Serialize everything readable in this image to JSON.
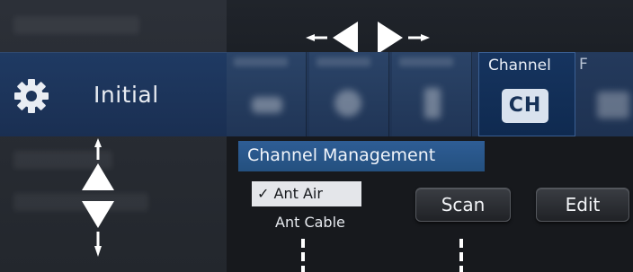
{
  "sidebar": {
    "selected_label": "Initial"
  },
  "tabs": {
    "channel_label": "Channel",
    "channel_icon_text": "CH",
    "next_label": "F"
  },
  "section": {
    "title": "Channel Management"
  },
  "sources": {
    "selected": "Ant Air",
    "other": "Ant Cable",
    "checkmark": "✓"
  },
  "buttons": {
    "scan": "Scan",
    "edit": "Edit"
  }
}
